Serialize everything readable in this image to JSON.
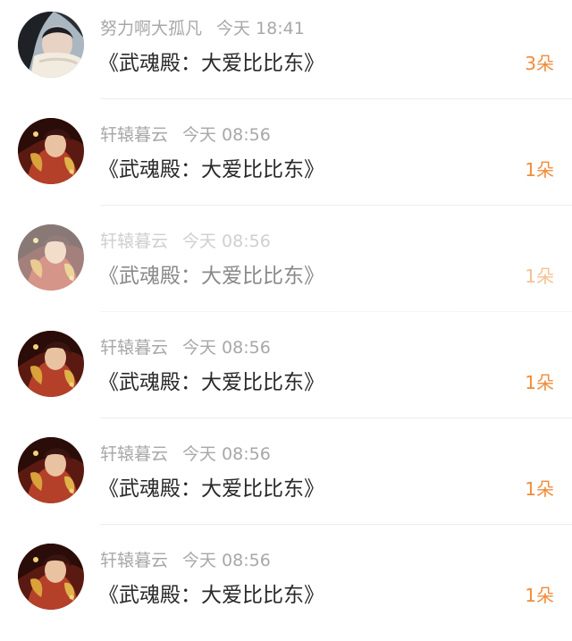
{
  "items": [
    {
      "username": "努力啊大孤凡",
      "time": "今天 18:41",
      "title": "《武魂殿：大爱比比东》",
      "count": "3朵"
    },
    {
      "username": "轩辕暮云",
      "time": "今天 08:56",
      "title": "《武魂殿：大爱比比东》",
      "count": "1朵"
    },
    {
      "username": "轩辕暮云",
      "time": "今天 08:56",
      "title": "《武魂殿：大爱比比东》",
      "count": "1朵"
    },
    {
      "username": "轩辕暮云",
      "time": "今天 08:56",
      "title": "《武魂殿：大爱比比东》",
      "count": "1朵"
    },
    {
      "username": "轩辕暮云",
      "time": "今天 08:56",
      "title": "《武魂殿：大爱比比东》",
      "count": "1朵"
    },
    {
      "username": "轩辕暮云",
      "time": "今天 08:56",
      "title": "《武魂殿：大爱比比东》",
      "count": "1朵"
    }
  ],
  "colors": {
    "accent": "#f08c3a",
    "meta_text": "#a8a8a8",
    "title_text": "#2a2a2a"
  }
}
